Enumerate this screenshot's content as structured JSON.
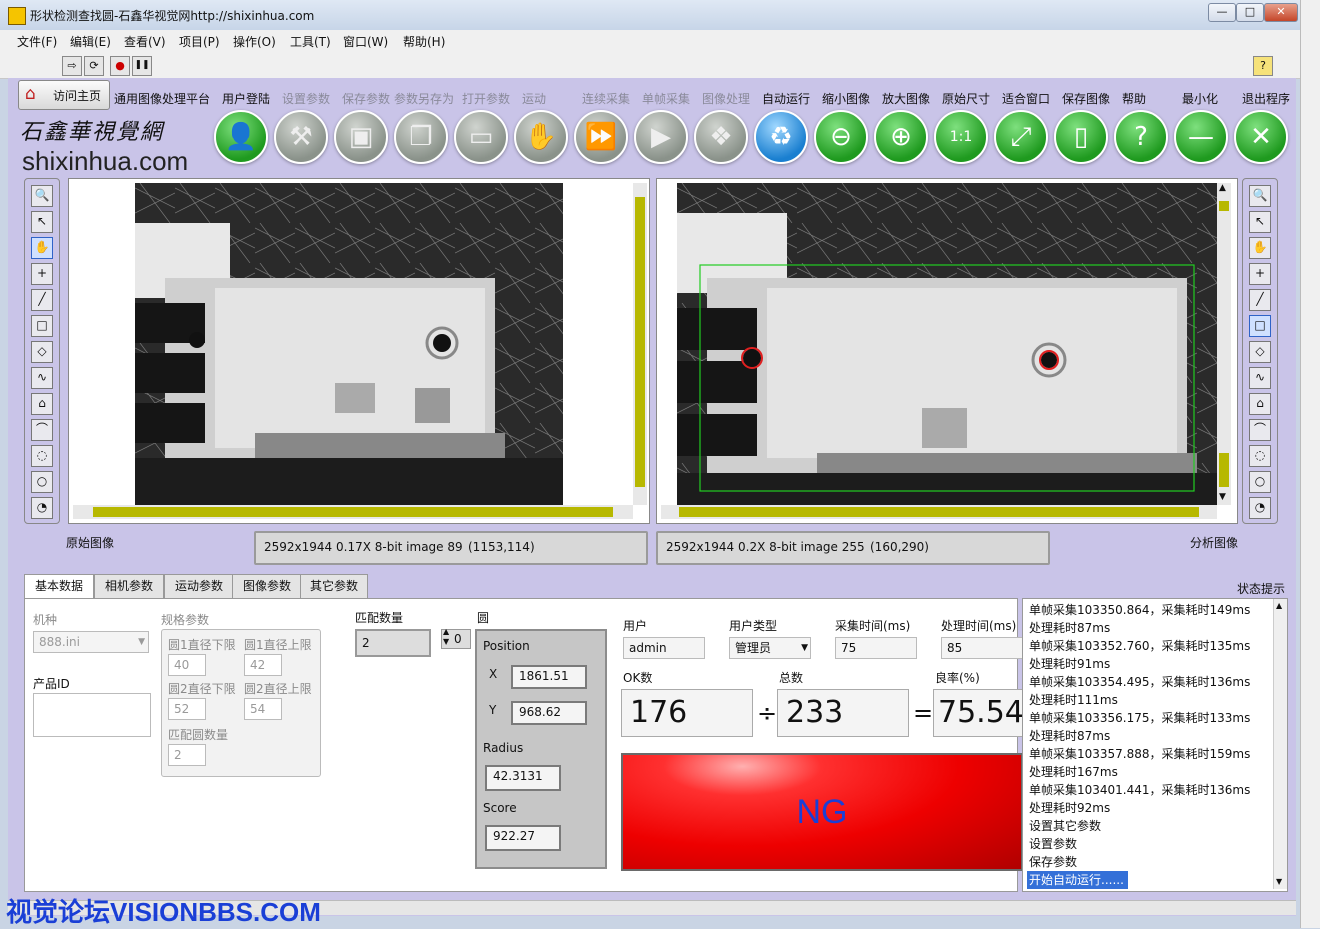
{
  "window": {
    "title": "形状检测查找圆-石鑫华视觉网http://shixinhua.com",
    "minimize": "—",
    "maximize": "□",
    "close": "✕"
  },
  "menu": [
    "文件(F)",
    "编辑(E)",
    "查看(V)",
    "项目(P)",
    "操作(O)",
    "工具(T)",
    "窗口(W)",
    "帮助(H)"
  ],
  "toolbar": {
    "run": "⇨",
    "run_continuous": "⟳",
    "abort": "●",
    "pause": "❚❚",
    "help": "?"
  },
  "nav": {
    "home_label": "访问主页",
    "platform_label": "通用图像处理平台",
    "logo_text": "shixinhua.com",
    "logo_brush": "石鑫華視覺網",
    "buttons": [
      {
        "label": "用户登陆",
        "glyph": "👤",
        "style": "green"
      },
      {
        "label": "设置参数",
        "glyph": "⚒",
        "style": "gray"
      },
      {
        "label": "保存参数",
        "glyph": "▣",
        "style": "gray"
      },
      {
        "label": "参数另存为",
        "glyph": "❐",
        "style": "gray"
      },
      {
        "label": "打开参数",
        "glyph": "▭",
        "style": "gray"
      },
      {
        "label": "运动",
        "glyph": "✋",
        "style": "gray"
      },
      {
        "label": "连续采集",
        "glyph": "⏩",
        "style": "gray"
      },
      {
        "label": "单帧采集",
        "glyph": "▶",
        "style": "gray"
      },
      {
        "label": "图像处理",
        "glyph": "❖",
        "style": "gray"
      },
      {
        "label": "自动运行",
        "glyph": "♻",
        "style": "recycle"
      },
      {
        "label": "缩小图像",
        "glyph": "⊖",
        "style": "green"
      },
      {
        "label": "放大图像",
        "glyph": "⊕",
        "style": "green"
      },
      {
        "label": "原始尺寸",
        "glyph": "1:1",
        "style": "green"
      },
      {
        "label": "适合窗口",
        "glyph": "⤢",
        "style": "green"
      },
      {
        "label": "保存图像",
        "glyph": "▯",
        "style": "green"
      },
      {
        "label": "帮助",
        "glyph": "?",
        "style": "green"
      },
      {
        "label": "最小化",
        "glyph": "—",
        "style": "green"
      },
      {
        "label": "退出程序",
        "glyph": "✕",
        "style": "green"
      }
    ],
    "disabled": [
      "设置参数",
      "保存参数",
      "参数另存为",
      "打开参数",
      "运动",
      "连续采集",
      "单帧采集",
      "图像处理"
    ]
  },
  "palette_tools": [
    "🔍",
    "↖",
    "✋",
    "+",
    "╱",
    "□",
    "◇",
    "∿",
    "⌂",
    "⌒",
    "◌",
    "○",
    "◔"
  ],
  "viewers": {
    "left": {
      "caption": "原始图像",
      "info": "2592x1944 0.17X 8-bit image 89",
      "coords": "(1153,114)"
    },
    "right": {
      "caption": "分析图像",
      "info": "2592x1944 0.2X 8-bit image 255",
      "coords": "(160,290)"
    }
  },
  "tabs": [
    "基本数据",
    "相机参数",
    "运动参数",
    "图像参数",
    "其它参数"
  ],
  "status_title": "状态提示",
  "basic": {
    "model_label": "机种",
    "model_value": "888.ini",
    "product_id_label": "产品ID",
    "product_id_value": "",
    "spec_label": "规格参数",
    "c1_min_label": "圆1直径下限",
    "c1_min": "40",
    "c1_max_label": "圆1直径上限",
    "c1_max": "42",
    "c2_min_label": "圆2直径下限",
    "c2_min": "52",
    "c2_max_label": "圆2直径上限",
    "c2_max": "54",
    "match_count_spec_label": "匹配圆数量",
    "match_count_spec": "2",
    "match_count_label": "匹配数量",
    "match_count": "2",
    "index_value": "0",
    "circle_label": "圆",
    "position_label": "Position",
    "x_label": "X",
    "x_value": "1861.51",
    "y_label": "Y",
    "y_value": "968.62",
    "radius_label": "Radius",
    "radius_value": "42.3131",
    "score_label": "Score",
    "score_value": "922.27",
    "user_label": "用户",
    "user_value": "admin",
    "user_type_label": "用户类型",
    "user_type_value": "管理员",
    "acq_time_label": "采集时间(ms)",
    "acq_time": "75",
    "proc_time_label": "处理时间(ms)",
    "proc_time": "85",
    "ok_label": "OK数",
    "ok_value": "176",
    "total_label": "总数",
    "total_value": "233",
    "yield_label": "良率(%)",
    "yield_value": "75.54",
    "div_sign": "÷",
    "eq_sign": "=",
    "result": "NG"
  },
  "status_log": [
    "单帧采集103350.864，采集耗时149ms",
    "处理耗时87ms",
    "单帧采集103352.760，采集耗时135ms",
    "处理耗时91ms",
    "单帧采集103354.495，采集耗时136ms",
    "处理耗时111ms",
    "单帧采集103356.175，采集耗时133ms",
    "处理耗时87ms",
    "单帧采集103357.888，采集耗时159ms",
    "处理耗时167ms",
    "单帧采集103401.441，采集耗时136ms",
    "处理耗时92ms",
    "设置其它参数",
    "设置参数",
    "保存参数",
    "开始自动运行......"
  ],
  "watermark": "视觉论坛VISIONBBS.COM",
  "colors": {
    "panel": "#c9c4e8",
    "ng_red": "#ee0000",
    "ng_text": "#1a3fd6",
    "roi_green": "#22cc22"
  }
}
